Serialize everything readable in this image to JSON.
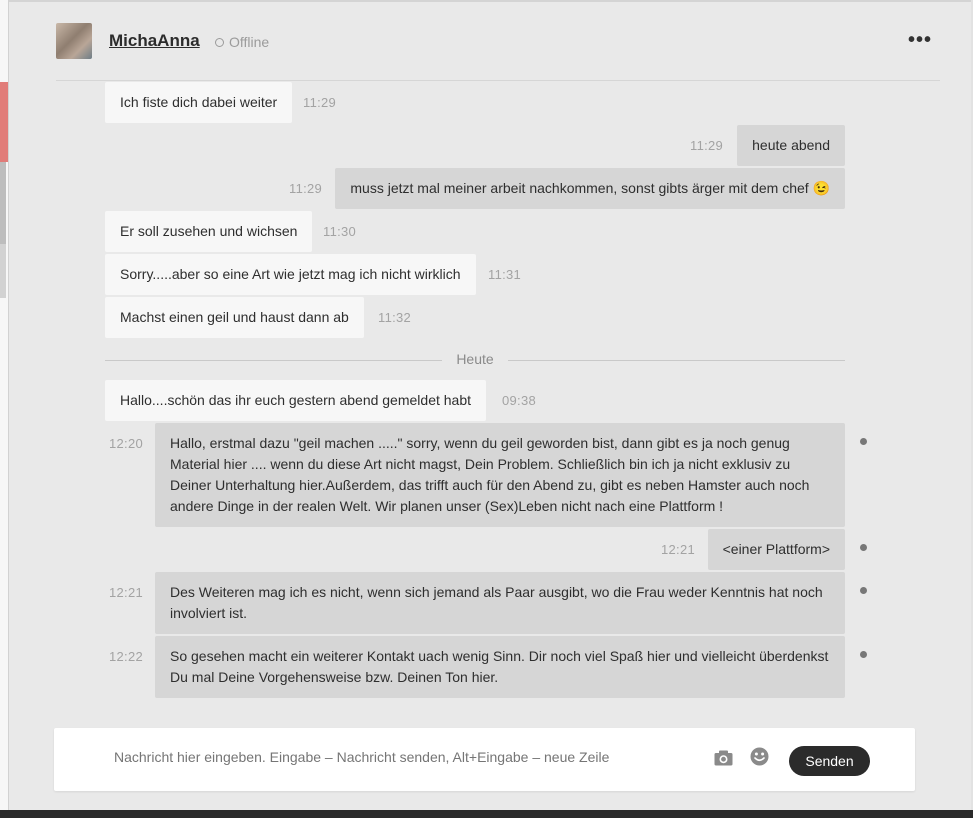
{
  "header": {
    "username": "MichaAnna",
    "status": "Offline",
    "menu_glyph": "•••"
  },
  "messages": [
    {
      "direction": "in",
      "text": "Ich fiste dich dabei weiter",
      "time": "11:29"
    },
    {
      "direction": "out",
      "text": "heute abend",
      "time": "11:29"
    },
    {
      "direction": "out",
      "text": "muss jetzt mal meiner arbeit nachkommen, sonst gibts ärger mit dem chef 😉",
      "time": "11:29"
    },
    {
      "direction": "in",
      "text": "Er soll zusehen und wichsen",
      "time": "11:30"
    },
    {
      "direction": "in",
      "text": "Sorry.....aber so eine Art wie jetzt mag ich nicht wirklich",
      "time": "11:31"
    },
    {
      "direction": "in",
      "text": "Machst einen geil und haust dann ab",
      "time": "11:32"
    },
    {
      "direction": "in",
      "text": "Hallo....schön das ihr euch gestern abend gemeldet habt",
      "time": "09:38"
    },
    {
      "direction": "out",
      "text": "Hallo, erstmal dazu \"geil machen .....\" sorry, wenn du geil geworden bist, dann gibt es ja noch genug Material hier .... wenn du diese Art nicht magst, Dein Problem. Schließlich bin ich ja nicht exklusiv zu Deiner Unterhaltung hier.Außerdem, das trifft auch für den Abend zu, gibt es neben Hamster auch noch andere Dinge in der realen Welt. Wir planen unser (Sex)Leben nicht nach eine Plattform !",
      "time": "12:20"
    },
    {
      "direction": "out",
      "text": "<einer Plattform>",
      "time": "12:21"
    },
    {
      "direction": "out",
      "text": "Des Weiteren mag ich es nicht, wenn sich jemand als Paar ausgibt, wo die Frau weder Kenntnis hat noch involviert ist.",
      "time": "12:21"
    },
    {
      "direction": "out",
      "text": "So gesehen macht ein weiterer Kontakt uach wenig Sinn. Dir noch viel Spaß hier und vielleicht überdenkst Du mal Deine Vorgehensweise bzw. Deinen Ton hier.",
      "time": "12:22"
    }
  ],
  "divider": {
    "label": "Heute"
  },
  "composer": {
    "placeholder": "Nachricht hier eingeben. Eingabe – Nachricht senden, Alt+Eingabe – neue Zeile",
    "value": "",
    "camera_icon": "camera-icon",
    "emoji_icon": "smiley-icon",
    "send_label": "Senden"
  },
  "colors": {
    "background": "#e9e9e9",
    "incoming_bubble": "#f7f7f7",
    "outgoing_bubble": "#d6d6d6",
    "send_button": "#2b2b2b",
    "timestamp": "#a3a3a3"
  }
}
